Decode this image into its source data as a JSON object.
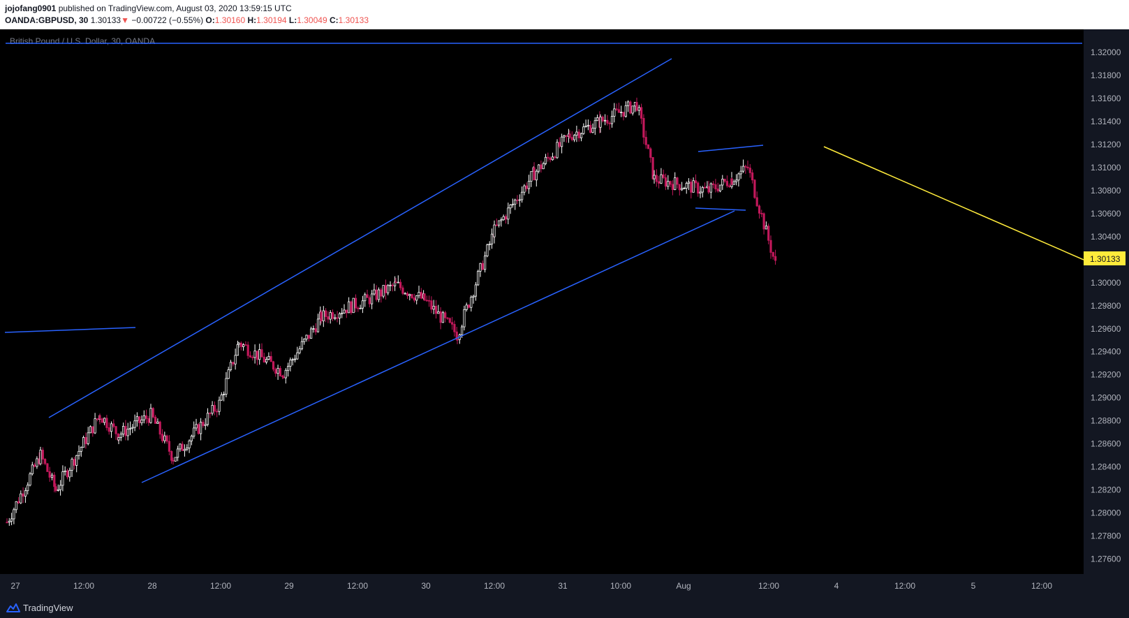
{
  "header": {
    "author": "jojofang0901",
    "published_text": "published on TradingView.com, August 03, 2020 13:59:15 UTC",
    "symbol": "OANDA:GBPUSD, 30",
    "last": "1.30133",
    "change_arrow": "▼",
    "change": "−0.00722 (−0.55%)",
    "o_label": "O:",
    "o_value": "1.30160",
    "h_label": "H:",
    "h_value": "1.30194",
    "l_label": "L:",
    "l_value": "1.30049",
    "c_label": "C:",
    "c_value": "1.30133"
  },
  "footer": {
    "brand": "TradingView",
    "logo_icon": "tradingview-logo-icon"
  },
  "colors": {
    "background": "#000000",
    "frame": "#131722",
    "axis_text": "#b2b5be",
    "up_candle": "#ffffff",
    "down_candle": "#c2185b",
    "trendline": "#2962ff",
    "forecast_line": "#ffeb3b",
    "price_label_bg": "#ffeb3b"
  },
  "chart_data": {
    "type": "candlestick",
    "title": "British Pound / U.S. Dollar, 30, OANDA",
    "y_axis": {
      "side": "right",
      "range": [
        1.2747,
        1.322
      ],
      "ticks": [
        "1.32000",
        "1.31800",
        "1.31600",
        "1.31400",
        "1.31200",
        "1.31000",
        "1.30800",
        "1.30600",
        "1.30400",
        "1.30200",
        "1.30000",
        "1.29800",
        "1.29600",
        "1.29400",
        "1.29200",
        "1.29000",
        "1.28800",
        "1.28600",
        "1.28400",
        "1.28200",
        "1.28000",
        "1.27800",
        "1.27600"
      ]
    },
    "x_axis": {
      "labels": [
        "27",
        "12:00",
        "28",
        "12:00",
        "29",
        "12:00",
        "30",
        "12:00",
        "31",
        "10:00",
        "Aug",
        "12:00",
        "4",
        "12:00",
        "5",
        "12:00"
      ]
    },
    "current_price": "1.30133",
    "approx_close_path": [
      {
        "t": "27 00:00",
        "close": 1.2792
      },
      {
        "t": "27 06:00",
        "close": 1.285
      },
      {
        "t": "27 09:00",
        "close": 1.282
      },
      {
        "t": "27 15:00",
        "close": 1.2885
      },
      {
        "t": "27 18:00",
        "close": 1.2868
      },
      {
        "t": "28 00:00",
        "close": 1.2885
      },
      {
        "t": "28 06:00",
        "close": 1.2848
      },
      {
        "t": "28 12:00",
        "close": 1.2895
      },
      {
        "t": "28 18:00",
        "close": 1.2948
      },
      {
        "t": "29 00:00",
        "close": 1.2922
      },
      {
        "t": "29 06:00",
        "close": 1.297
      },
      {
        "t": "29 12:00",
        "close": 1.2985
      },
      {
        "t": "29 18:00",
        "close": 1.2998
      },
      {
        "t": "30 00:00",
        "close": 1.2985
      },
      {
        "t": "30 06:00",
        "close": 1.2955
      },
      {
        "t": "30 12:00",
        "close": 1.3045
      },
      {
        "t": "30 18:00",
        "close": 1.3095
      },
      {
        "t": "31 00:00",
        "close": 1.3128
      },
      {
        "t": "31 06:00",
        "close": 1.314
      },
      {
        "t": "31 12:00",
        "close": 1.3155
      },
      {
        "t": "31 18:00",
        "close": 1.309
      },
      {
        "t": "03 00:00",
        "close": 1.308
      },
      {
        "t": "03 06:00",
        "close": 1.309
      },
      {
        "t": "03 09:00",
        "close": 1.31
      },
      {
        "t": "03 12:00",
        "close": 1.3013
      }
    ],
    "annotations": [
      {
        "name": "channel-upper",
        "color": "trendline"
      },
      {
        "name": "channel-lower",
        "color": "trendline"
      },
      {
        "name": "horizontal-level-top",
        "color": "trendline"
      },
      {
        "name": "left-level",
        "color": "trendline"
      },
      {
        "name": "flag-upper",
        "color": "trendline"
      },
      {
        "name": "flag-lower",
        "color": "trendline"
      },
      {
        "name": "forecast-line",
        "color": "forecast_line"
      }
    ],
    "grid": false,
    "legend": "none"
  }
}
